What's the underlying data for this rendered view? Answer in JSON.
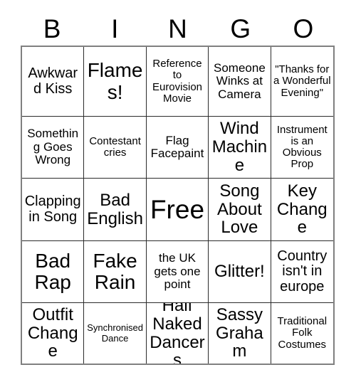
{
  "card": {
    "title_letters": [
      "B",
      "I",
      "N",
      "G",
      "O"
    ],
    "free_space_label": "Free",
    "colors": {
      "background": "#ffffff",
      "outer_border": "#808080",
      "inner_border": "#2b2b2b",
      "text": "#000000"
    },
    "grid": {
      "columns": 5,
      "rows": 5,
      "cells": [
        [
          {
            "text": "Awkward Kiss",
            "size": "lg"
          },
          {
            "text": "Flames!",
            "size": "xxl"
          },
          {
            "text": "Reference to Eurovision Movie",
            "size": "sm"
          },
          {
            "text": "Someone Winks at Camera",
            "size": "md"
          },
          {
            "text": "\"Thanks for a Wonderful Evening\"",
            "size": "sm"
          }
        ],
        [
          {
            "text": "Something Goes Wrong",
            "size": "md"
          },
          {
            "text": "Contestant cries",
            "size": "sm"
          },
          {
            "text": "Flag Facepaint",
            "size": "md"
          },
          {
            "text": "Wind Machine",
            "size": "xl"
          },
          {
            "text": "Instrument is an Obvious Prop",
            "size": "sm"
          }
        ],
        [
          {
            "text": "Clapping in Song",
            "size": "lg"
          },
          {
            "text": "Bad English",
            "size": "xl"
          },
          {
            "text": "Free",
            "size": "free"
          },
          {
            "text": "Song About Love",
            "size": "xl"
          },
          {
            "text": "Key Change",
            "size": "xl"
          }
        ],
        [
          {
            "text": "Bad Rap",
            "size": "xxl"
          },
          {
            "text": "Fake Rain",
            "size": "xxl"
          },
          {
            "text": "the UK gets one point",
            "size": "md"
          },
          {
            "text": "Glitter!",
            "size": "xl"
          },
          {
            "text": "Country isn't in europe",
            "size": "lg"
          }
        ],
        [
          {
            "text": "Outfit Change",
            "size": "xl"
          },
          {
            "text": "Synchronised Dance",
            "size": "xs"
          },
          {
            "text": "Half Naked Dancers",
            "size": "xl"
          },
          {
            "text": "Sassy Graham",
            "size": "xl"
          },
          {
            "text": "Traditional Folk Costumes",
            "size": "sm"
          }
        ]
      ]
    }
  }
}
